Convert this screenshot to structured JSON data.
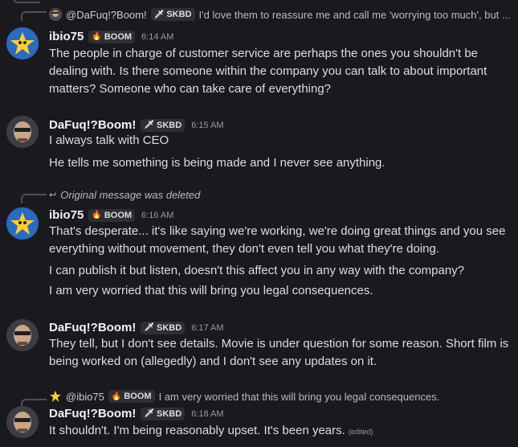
{
  "reply1": {
    "name": "@DaFuq!?Boom!",
    "tag": "SKBD",
    "text": "I'd love them to reassure me and call me 'worrying too much', but ..."
  },
  "msg1": {
    "user": "ibio75",
    "tag": "BOOM",
    "time": "6:14 AM",
    "lines": [
      "The people in charge of customer service are perhaps the ones you shouldn't be dealing with. Is there someone within the company you can talk to about important matters? Someone who can take care of everything?"
    ]
  },
  "msg2": {
    "user": "DaFuq!?Boom!",
    "tag": "SKBD",
    "time": "6:15 AM",
    "lines": [
      "I always talk with CEO",
      "He tells me something is being made and I never see anything."
    ]
  },
  "reply2": {
    "text": "Original message was deleted"
  },
  "msg3": {
    "user": "ibio75",
    "tag": "BOOM",
    "time": "6:16 AM",
    "lines": [
      "That's desperate... it's like saying we're working, we're doing great things and you see everything without movement, they don't even tell you what they're doing.",
      "I can publish it but listen, doesn't this affect you in any way with the company?",
      "I am very worried that this will bring you legal consequences."
    ]
  },
  "msg4": {
    "user": "DaFuq!?Boom!",
    "tag": "SKBD",
    "time": "6:17 AM",
    "lines": [
      "They tell, but I don't see details. Movie is under question for some reason. Short film is being worked on (allegedly) and I don't see any updates on it."
    ]
  },
  "reply3": {
    "name": "@ibio75",
    "tag": "BOOM",
    "text": "I am very worried that this will bring you legal consequences."
  },
  "msg5": {
    "user": "DaFuq!?Boom!",
    "tag": "SKBD",
    "time": "6:18 AM",
    "lines": [
      "It shouldn't. I'm being reasonably upset. It's been years."
    ],
    "edited": "(edited)"
  },
  "colors": {
    "background": "#1a1a1e",
    "text": "#dbdee1",
    "muted": "#949ba4",
    "tag_bg": "#2e2f34"
  },
  "icons": {
    "boom_tag": "fire-icon",
    "skbd_tag": "sword-icon",
    "reply": "reply-arrow-icon"
  }
}
